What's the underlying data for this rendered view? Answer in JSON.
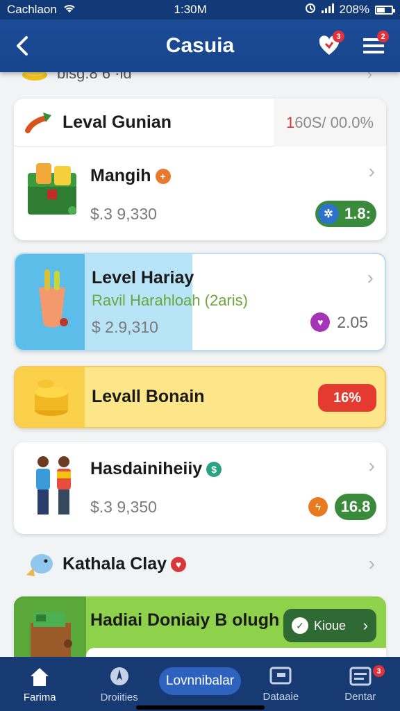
{
  "status_bar": {
    "carrier": "Cachlaon",
    "time": "1:30M",
    "battery": "208%"
  },
  "app_bar": {
    "title": "Casuia",
    "back_icon": "back-chevron-icon",
    "heart_badge": "3",
    "menu_badge": "2"
  },
  "peek_item": {
    "text": "bisg.8 6 ·ld"
  },
  "group_header": {
    "title": "Leval Gunian",
    "progress_accent": "1",
    "progress_rest": "60S/ 00.0%"
  },
  "items": [
    {
      "name": "Mangih",
      "price": "$.3 9,330",
      "badge_value": "1.8:",
      "badge_icon": "star-icon"
    },
    {
      "name": "Level Hariay",
      "subtitle": "Ravil Harahloah (2aris)",
      "price": "$ 2.9,310",
      "value": "2.05"
    },
    {
      "name": "Levall Bonain",
      "percent": "16%"
    },
    {
      "name": "Hasdainiheiiy",
      "price": "$.3 9,350",
      "badge_value": "16.8"
    },
    {
      "name": "Kathala Clay"
    },
    {
      "name": "Hadiai Doniaiy B olugh",
      "button_label": "Kioue"
    }
  ],
  "bottom_nav": [
    {
      "label": "Farima",
      "icon": "home-icon"
    },
    {
      "label": "Droiities",
      "icon": "compass-icon"
    },
    {
      "label": "Lovnnibalar",
      "icon": ""
    },
    {
      "label": "Dataaie",
      "icon": "dashboard-icon"
    },
    {
      "label": "Dentar",
      "icon": "list-icon",
      "badge": "3"
    }
  ],
  "colors": {
    "app_bar": "#17458c",
    "nav": "#173a72",
    "green_pill": "#3a8a3c",
    "bonus_red": "#e53a2f"
  }
}
